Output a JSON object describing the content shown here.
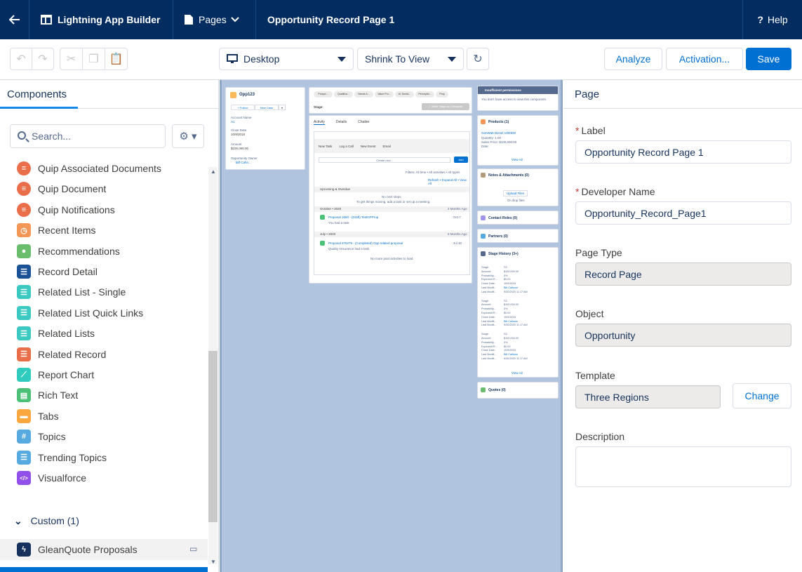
{
  "topbar": {
    "app_name": "Lightning App Builder",
    "pages_label": "Pages",
    "page_title": "Opportunity Record Page 1",
    "help_label": "Help"
  },
  "toolbar": {
    "device_select": "Desktop",
    "view_select": "Shrink To View",
    "analyze_label": "Analyze",
    "activation_label": "Activation...",
    "save_label": "Save"
  },
  "components_panel": {
    "title": "Components",
    "search_placeholder": "Search...",
    "items": [
      {
        "label": "Quip Associated Documents",
        "color": "#e96e49",
        "icon": "quip-icon"
      },
      {
        "label": "Quip Document",
        "color": "#e96e49",
        "icon": "quip-icon"
      },
      {
        "label": "Quip Notifications",
        "color": "#e96e49",
        "icon": "quip-icon"
      },
      {
        "label": "Recent Items",
        "color": "#f49756",
        "icon": "clock-icon"
      },
      {
        "label": "Recommendations",
        "color": "#6bbd6e",
        "icon": "lightbulb-icon"
      },
      {
        "label": "Record Detail",
        "color": "#1b5297",
        "icon": "record-icon"
      },
      {
        "label": "Related List - Single",
        "color": "#3bc9c1",
        "icon": "list-icon"
      },
      {
        "label": "Related List Quick Links",
        "color": "#3bc9c1",
        "icon": "list-icon"
      },
      {
        "label": "Related Lists",
        "color": "#3bc9c1",
        "icon": "list-icon"
      },
      {
        "label": "Related Record",
        "color": "#e96e49",
        "icon": "record-icon"
      },
      {
        "label": "Report Chart",
        "color": "#2ecbbe",
        "icon": "chart-icon"
      },
      {
        "label": "Rich Text",
        "color": "#4bc076",
        "icon": "text-icon"
      },
      {
        "label": "Tabs",
        "color": "#f9a73e",
        "icon": "tabs-icon"
      },
      {
        "label": "Topics",
        "color": "#56aadf",
        "icon": "hash-icon"
      },
      {
        "label": "Trending Topics",
        "color": "#56aadf",
        "icon": "list-icon"
      },
      {
        "label": "Visualforce",
        "color": "#9050e9",
        "icon": "code-icon"
      }
    ],
    "custom_section": "Custom (1)",
    "custom_items": [
      {
        "label": "GleanQuote Proposals",
        "color": "#16325c"
      }
    ]
  },
  "canvas": {
    "highlights": {
      "name": "Opp123",
      "follow": "+ Follow",
      "new_case": "New Case",
      "account_name_label": "Account Name",
      "account_name": "A1",
      "close_date_label": "Close Date",
      "close_date": "10/9/2018",
      "amount_label": "Amount",
      "amount": "$100,000.00",
      "owner_label": "Opportunity Owner",
      "owner": "Bill Cahn..."
    },
    "path": {
      "steps": [
        "Prospe...",
        "Qualifica...",
        "Needs A...",
        "Value Pro...",
        "Id. Decisi...",
        "Perceptio...",
        "Prop"
      ],
      "stage_label": "Stage:",
      "complete_btn": "✓ Mark Stage as Complete"
    },
    "activity": {
      "tabs": [
        "Activity",
        "Details",
        "Chatter"
      ],
      "subtabs": [
        "New Task",
        "Log a Call",
        "New Event",
        "Email"
      ],
      "create_placeholder": "Create new...",
      "add_btn": "Add",
      "filters": "Filters: All time • All activities • All types",
      "refresh_links": "Refresh • Expand All • View All",
      "upcoming": "Upcoming & Overdue",
      "no_next": "No next steps.",
      "no_next_sub": "To get things moving, add a task or set up a meeting.",
      "month1": "October • 2020",
      "month1_ago": "2 Months Ago",
      "task1": "Proposal 1650 - (Draft) TestGPProp",
      "task1_sub": "You had a task",
      "task1_date": "Oct 7",
      "month2": "July • 2020",
      "month2_ago": "5 Months Ago",
      "task2": "Proposal 376279 - (Completed) Opp related proposal",
      "task2_sub": "Quality Assurance had a task",
      "task2_date": "Jul 30",
      "no_more": "No more past activities to load."
    },
    "sidebar": {
      "insufficient": "Insufficient permissions",
      "insufficient_sub": "You don't have access to view this component.",
      "products": "Products (1)",
      "product_name": "GenWatt Diesel 1000kW",
      "product_qty": "Quantity:  1.00",
      "product_price": "Sales Price:  $100,000.00",
      "product_date": "Date:",
      "view_all": "View All",
      "notes": "Notes & Attachments (0)",
      "upload": "Upload Files",
      "drop": "Or drop files",
      "contact_roles": "Contact Roles (0)",
      "partners": "Partners (0)",
      "stage_history": "Stage History (3+)",
      "history_rows": [
        [
          "Stage:",
          "S3"
        ],
        [
          "Amount:",
          "$100,000.00"
        ],
        [
          "Probability...",
          "0%"
        ],
        [
          "Expected R...",
          "$0.00"
        ],
        [
          "Close Date:",
          "10/9/2018"
        ],
        [
          "Last Modifi...",
          "Bill Calhoun"
        ],
        [
          "Last Modifi...",
          "9/30/2020 11:17 AM"
        ]
      ],
      "quotes": "Quotes (0)"
    }
  },
  "properties": {
    "title": "Page",
    "label_label": "Label",
    "label_value": "Opportunity Record Page 1",
    "dev_name_label": "Developer Name",
    "dev_name_value": "Opportunity_Record_Page1",
    "page_type_label": "Page Type",
    "page_type_value": "Record Page",
    "object_label": "Object",
    "object_value": "Opportunity",
    "template_label": "Template",
    "template_value": "Three Regions",
    "change_label": "Change",
    "description_label": "Description",
    "description_value": ""
  }
}
